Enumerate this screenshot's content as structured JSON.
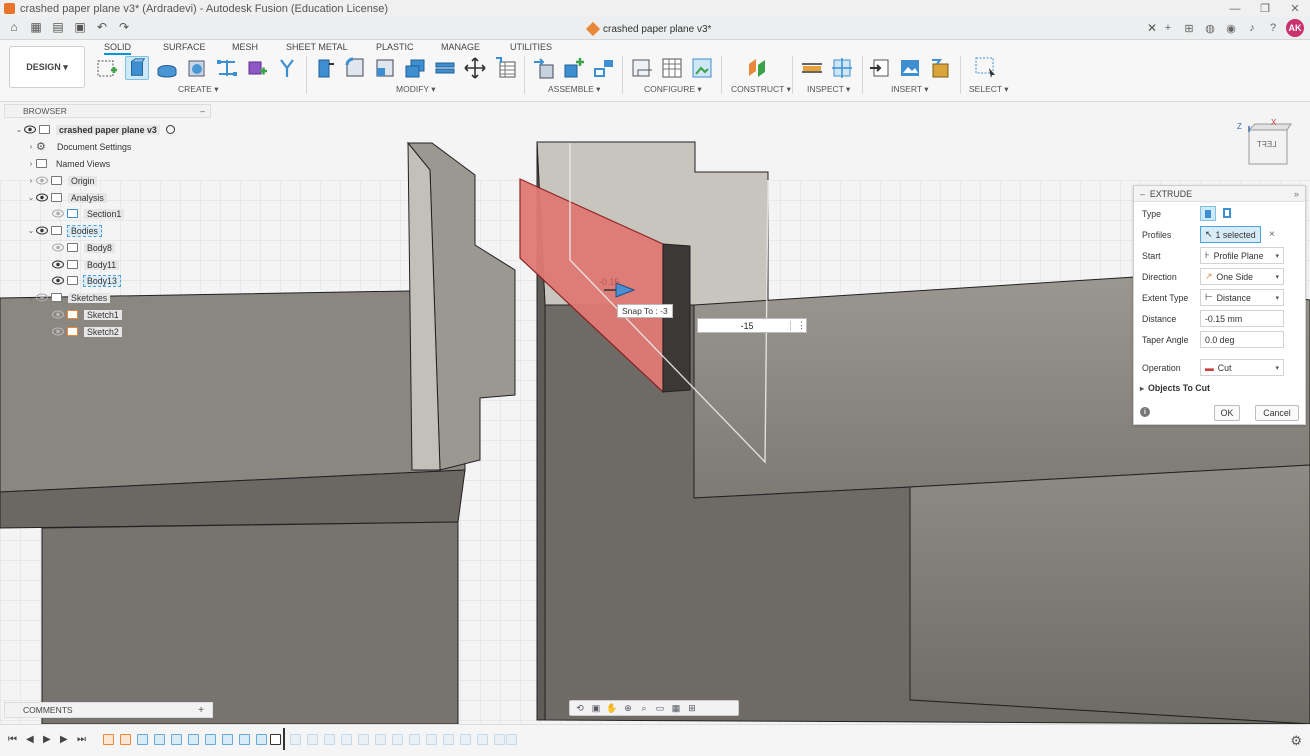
{
  "window": {
    "title": "crashed paper plane v3* (Ardradevi) - Autodesk Fusion (Education License)",
    "controls": [
      "—",
      "❐",
      "✕"
    ]
  },
  "document_tab": {
    "label": "crashed paper plane v3*",
    "close": "✕"
  },
  "user": {
    "initials": "AK"
  },
  "ribbon": {
    "workspace": "DESIGN ▾",
    "tabs": [
      "SOLID",
      "SURFACE",
      "MESH",
      "SHEET METAL",
      "PLASTIC",
      "MANAGE",
      "UTILITIES"
    ],
    "groups": [
      "CREATE ▾",
      "MODIFY ▾",
      "ASSEMBLE ▾",
      "CONFIGURE ▾",
      "CONSTRUCT ▾",
      "INSPECT ▾",
      "INSERT ▾",
      "SELECT ▾"
    ]
  },
  "browser": {
    "title": "BROWSER",
    "collapse": "–",
    "root": "crashed paper plane v3",
    "items": [
      {
        "label": "Document Settings"
      },
      {
        "label": "Named Views"
      },
      {
        "label": "Origin"
      },
      {
        "label": "Analysis"
      },
      {
        "label": "Section1"
      },
      {
        "label": "Bodies"
      },
      {
        "label": "Body8"
      },
      {
        "label": "Body11"
      },
      {
        "label": "Body13"
      },
      {
        "label": "Sketches"
      },
      {
        "label": "Sketch1"
      },
      {
        "label": "Sketch2"
      }
    ]
  },
  "viewcube": {
    "face": "LEFT",
    "axis_z": "Z",
    "axis_x": "X"
  },
  "canvas": {
    "distance_label": "-0.15",
    "snap_tooltip": "Snap To : -3",
    "distance_input": "-15",
    "menu_dots": "⋮"
  },
  "extrude": {
    "title": "EXTRUDE",
    "rows": {
      "type_label": "Type",
      "profiles_label": "Profiles",
      "profiles_value": "1 selected",
      "start_label": "Start",
      "start_value": "Profile Plane",
      "direction_label": "Direction",
      "direction_value": "One Side",
      "extent_label": "Extent Type",
      "extent_value": "Distance",
      "distance_label": "Distance",
      "distance_value": "-0.15 mm",
      "taper_label": "Taper Angle",
      "taper_value": "0.0 deg",
      "operation_label": "Operation",
      "operation_value": "Cut",
      "objects_label": "Objects To Cut"
    },
    "ok": "OK",
    "cancel": "Cancel"
  },
  "comments": {
    "label": "COMMENTS",
    "add": "+"
  },
  "colors": {
    "accent": "#0696d7",
    "profile_fill": "#e07a74",
    "avatar": "#c9326d",
    "model_face": "#8d8a84"
  }
}
